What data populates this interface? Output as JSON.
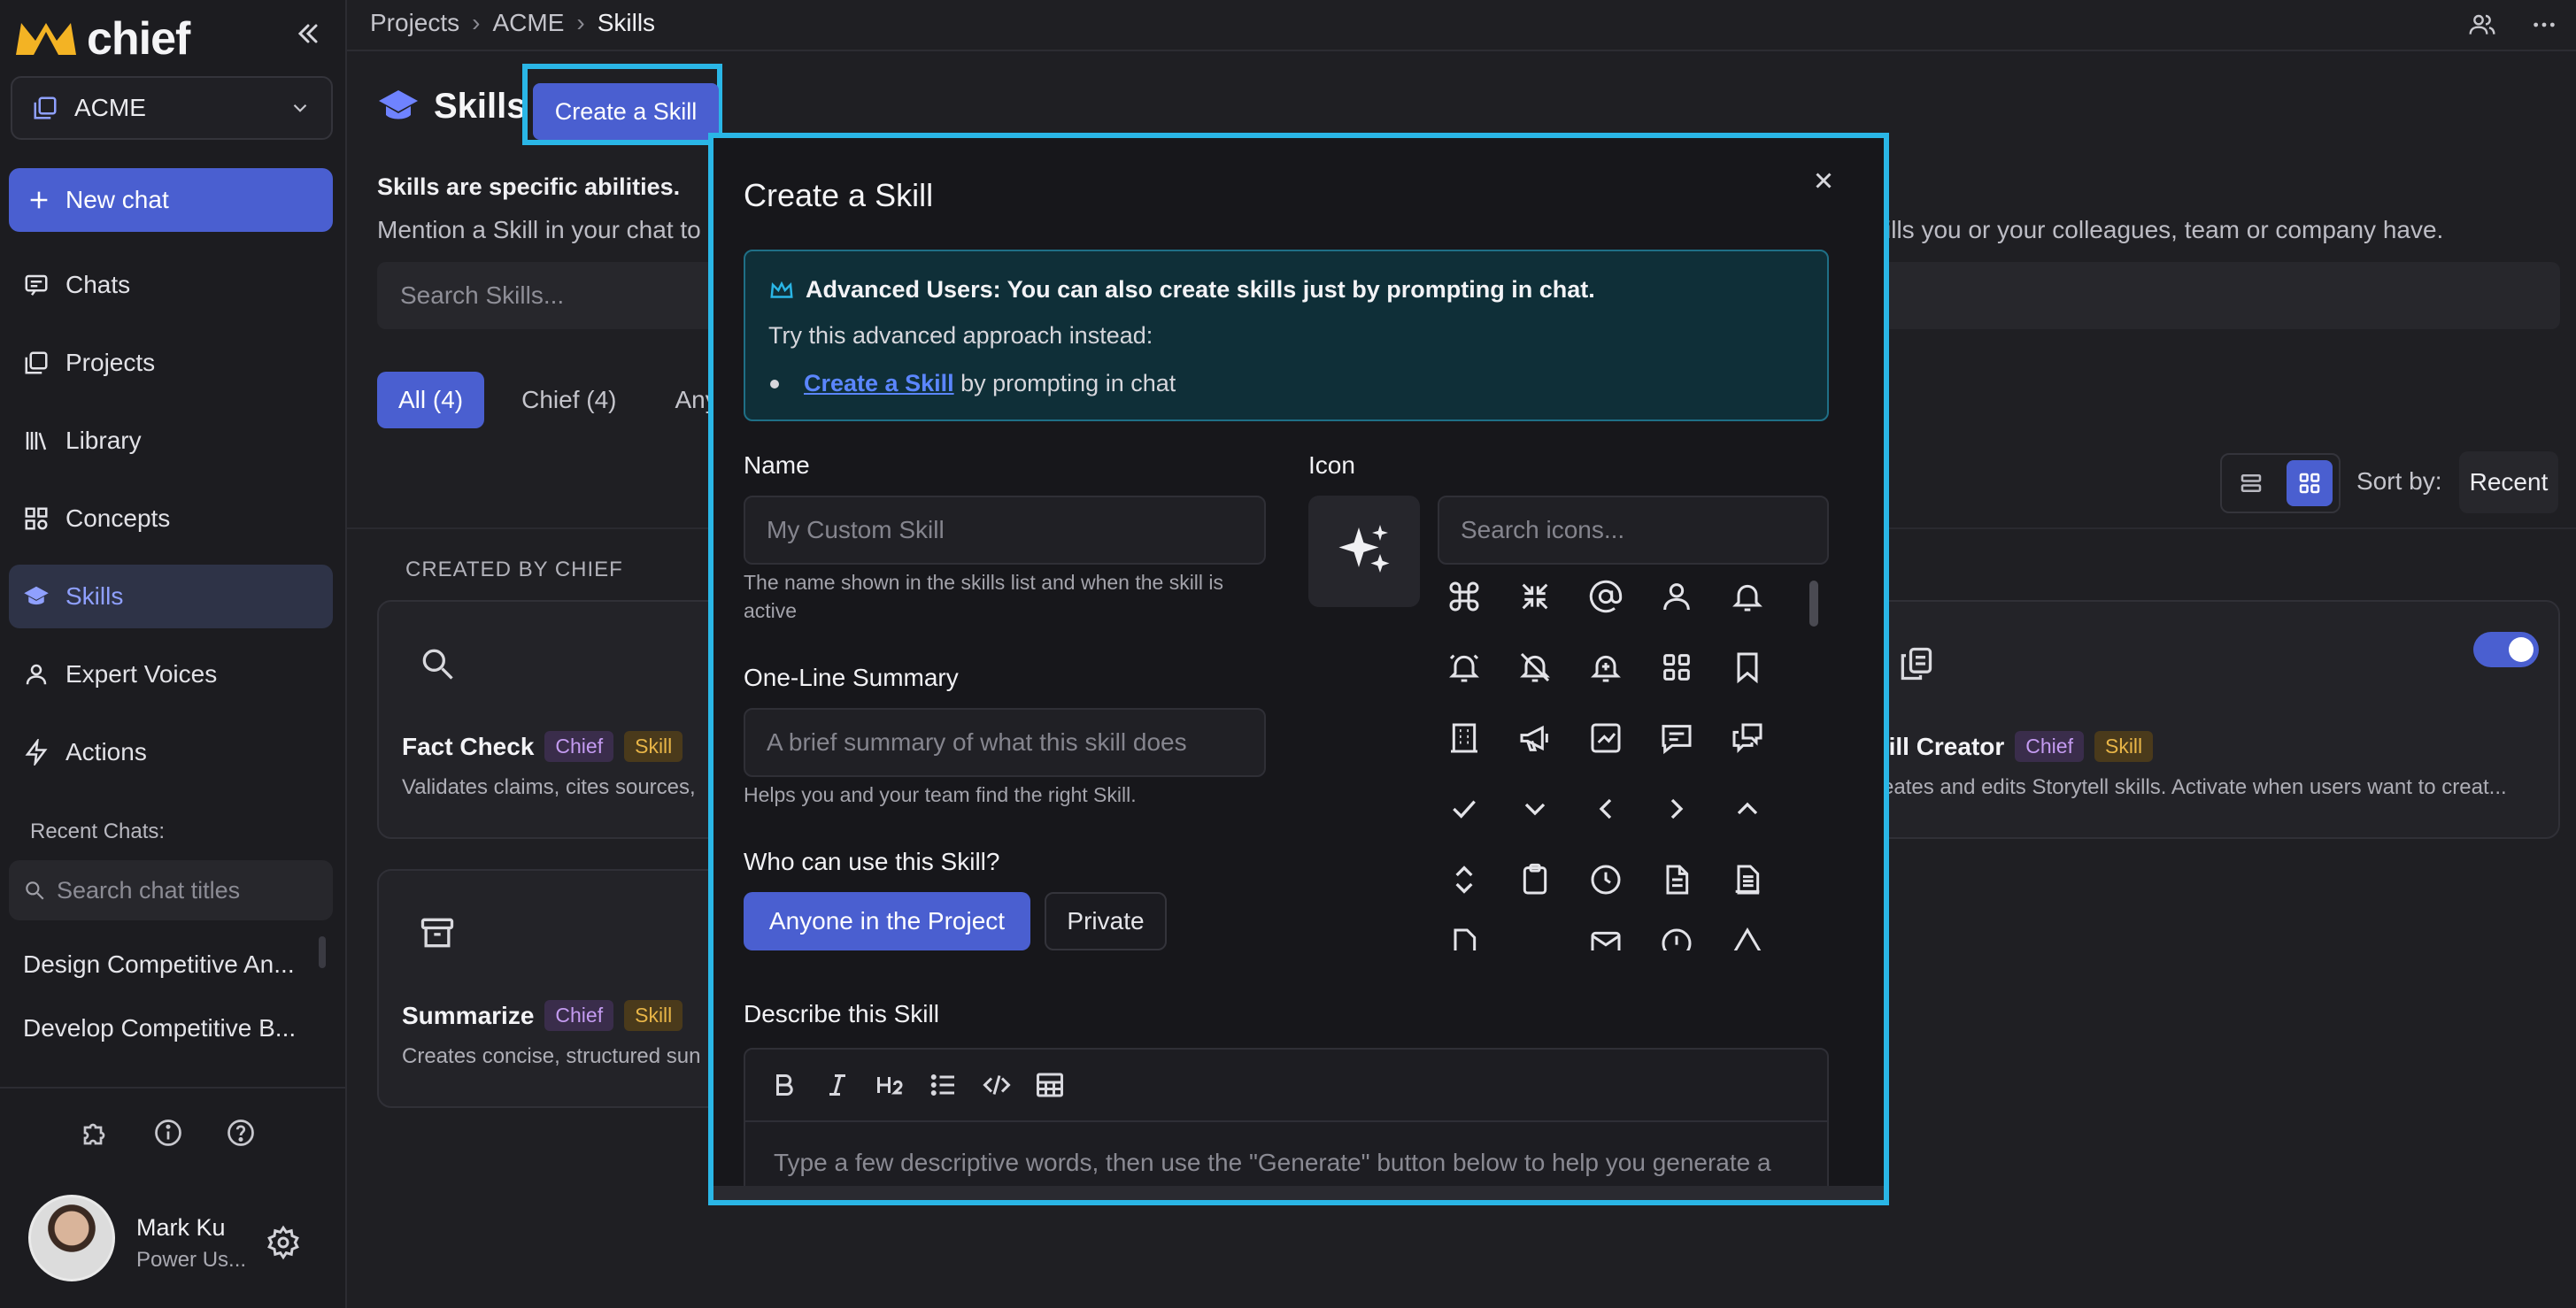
{
  "app": {
    "name": "chief"
  },
  "workspace": {
    "name": "ACME"
  },
  "sidebar": {
    "new_chat": "New chat",
    "items": [
      {
        "label": "Chats"
      },
      {
        "label": "Projects"
      },
      {
        "label": "Library"
      },
      {
        "label": "Concepts"
      },
      {
        "label": "Skills",
        "active": true
      },
      {
        "label": "Expert Voices"
      },
      {
        "label": "Actions"
      }
    ],
    "recent_heading": "Recent Chats:",
    "search_placeholder": "Search chat titles",
    "recent_chats": [
      "Design Competitive An...",
      "Develop Competitive B..."
    ]
  },
  "user": {
    "name": "Mark Ku",
    "role": "Power Us..."
  },
  "breadcrumb": [
    "Projects",
    "ACME",
    "Skills"
  ],
  "page": {
    "title": "Skills",
    "create_button": "Create a Skill",
    "subtitle_bold": "Skills are specific abilities.",
    "subtitle_start": "Mention a Skill in your chat to",
    "subtitle_end": "kills you or your colleagues, team or company have.",
    "search_placeholder": "Search Skills...",
    "tabs": [
      {
        "label": "All (4)",
        "active": true
      },
      {
        "label": "Chief (4)"
      },
      {
        "label": "Any"
      }
    ],
    "sort_label": "Sort by:",
    "sort_value": "Recent",
    "section_heading": "CREATED BY CHIEF",
    "cards": [
      {
        "title": "Fact Check",
        "badges": [
          "Chief",
          "Skill"
        ],
        "description": "Validates claims, cites sources,",
        "icon": "search-icon"
      },
      {
        "title": "kill Creator",
        "badges": [
          "Chief",
          "Skill"
        ],
        "description": "reates and edits Storytell skills. Activate when users want to creat...",
        "icon": "copy-icon",
        "enabled": true
      },
      {
        "title": "Summarize",
        "badges": [
          "Chief",
          "Skill"
        ],
        "description": "Creates concise, structured sun",
        "icon": "archive-icon"
      }
    ]
  },
  "modal": {
    "title": "Create a Skill",
    "notice": {
      "heading": "Advanced Users: You can also create skills just by prompting in chat.",
      "sub": "Try this advanced approach instead:",
      "link": "Create a Skill",
      "link_tail": "by prompting in chat"
    },
    "name": {
      "label": "Name",
      "placeholder": "My Custom Skill",
      "help": "The name shown in the skills list and when the skill is active"
    },
    "icon": {
      "label": "Icon",
      "search_placeholder": "Search icons...",
      "selected": "sparkles-icon"
    },
    "summary": {
      "label": "One-Line Summary",
      "placeholder": "A brief summary of what this skill does",
      "help": "Helps you and your team find the right Skill."
    },
    "visibility": {
      "label": "Who can use this Skill?",
      "options": [
        {
          "label": "Anyone in the Project",
          "active": true
        },
        {
          "label": "Private"
        }
      ]
    },
    "describe": {
      "label": "Describe this Skill",
      "placeholder": "Type a few descriptive words, then use the \"Generate\" button below to help you generate a"
    }
  },
  "colors": {
    "accent": "#4a5fd0",
    "highlight": "#2ab6e6",
    "chief_badge": "#c49bf1",
    "skill_badge": "#e8b547"
  }
}
